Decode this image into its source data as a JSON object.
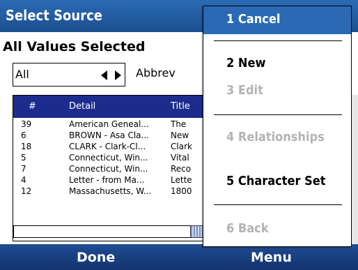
{
  "titlebar": {
    "title": "Select Source"
  },
  "filter": {
    "heading": "All Values Selected",
    "picker_value": "All",
    "sort_label": "Abbrev"
  },
  "grid": {
    "columns": [
      "#",
      "Detail",
      "Title"
    ],
    "rows": [
      {
        "num": "39",
        "detail": "American Geneal...",
        "title": "The"
      },
      {
        "num": "6",
        "detail": "BROWN - Asa Cla...",
        "title": "New"
      },
      {
        "num": "18",
        "detail": "CLARK - Clark-Cl...",
        "title": "Clark"
      },
      {
        "num": "5",
        "detail": "Connecticut, Win...",
        "title": "Vital"
      },
      {
        "num": "7",
        "detail": "Connecticut, Win...",
        "title": "Reco"
      },
      {
        "num": "4",
        "detail": "Letter - from Ma...",
        "title": "Lette"
      },
      {
        "num": "12",
        "detail": "Massachusetts, W...",
        "title": "1800"
      }
    ]
  },
  "menu": {
    "items": [
      {
        "label": "1 Cancel",
        "state": "selected"
      },
      {
        "label": "2 New",
        "state": "enabled"
      },
      {
        "label": "3 Edit",
        "state": "disabled"
      },
      {
        "label": "4 Relationships",
        "state": "disabled"
      },
      {
        "label": "5 Character Set",
        "state": "enabled"
      },
      {
        "label": "6 Back",
        "state": "disabled"
      }
    ]
  },
  "softkeys": {
    "left": "Done",
    "right": "Menu"
  },
  "colors": {
    "titlebar": "#2a6ab4",
    "grid_header": "#1d2c8c",
    "softkey_bar": "#1e4c94",
    "menu_selected": "#2a6ab4",
    "disabled_text": "#b3b3b3"
  }
}
